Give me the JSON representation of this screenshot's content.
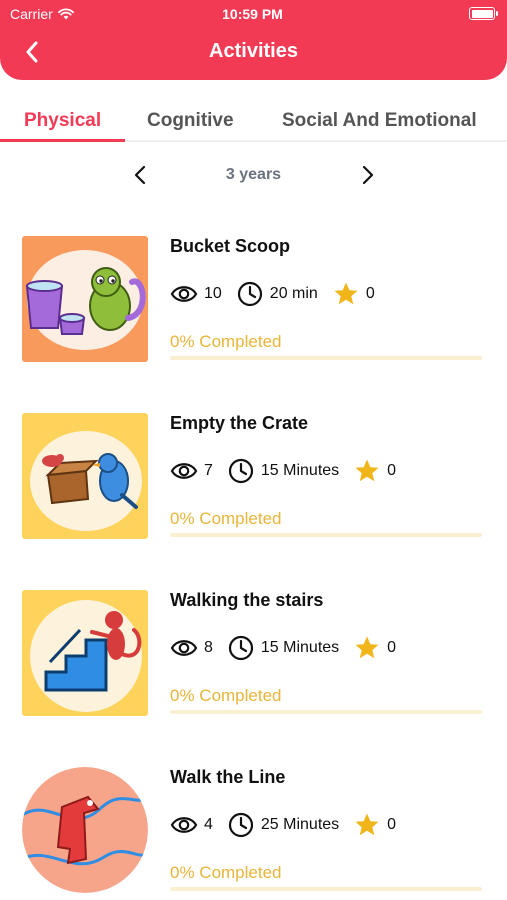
{
  "status_bar": {
    "carrier": "Carrier",
    "time": "10:59 PM"
  },
  "header": {
    "title": "Activities",
    "back_icon": "chevron-left-icon"
  },
  "tabs": [
    {
      "label": "Physical",
      "active": true
    },
    {
      "label": "Cognitive",
      "active": false
    },
    {
      "label": "Social And Emotional",
      "active": false
    }
  ],
  "age_selector": {
    "label": "3 years"
  },
  "colors": {
    "accent": "#f33a55",
    "progress": "#e8b53a",
    "progress_track": "#fbefd2"
  },
  "activities": [
    {
      "title": "Bucket Scoop",
      "views": "10",
      "duration": "20 min",
      "stars": "0",
      "completed_label": "0% Completed",
      "progress": 0,
      "thumb_bg": "#f79a5c"
    },
    {
      "title": "Empty the Crate",
      "views": "7",
      "duration": "15 Minutes",
      "stars": "0",
      "completed_label": "0% Completed",
      "progress": 0,
      "thumb_bg": "#fdd35c"
    },
    {
      "title": "Walking the stairs",
      "views": "8",
      "duration": "15 Minutes",
      "stars": "0",
      "completed_label": "0% Completed",
      "progress": 0,
      "thumb_bg": "#fdd35c"
    },
    {
      "title": "Walk the Line",
      "views": "4",
      "duration": "25 Minutes",
      "stars": "0",
      "completed_label": "0% Completed",
      "progress": 0,
      "thumb_bg": "#f6a58a"
    }
  ]
}
